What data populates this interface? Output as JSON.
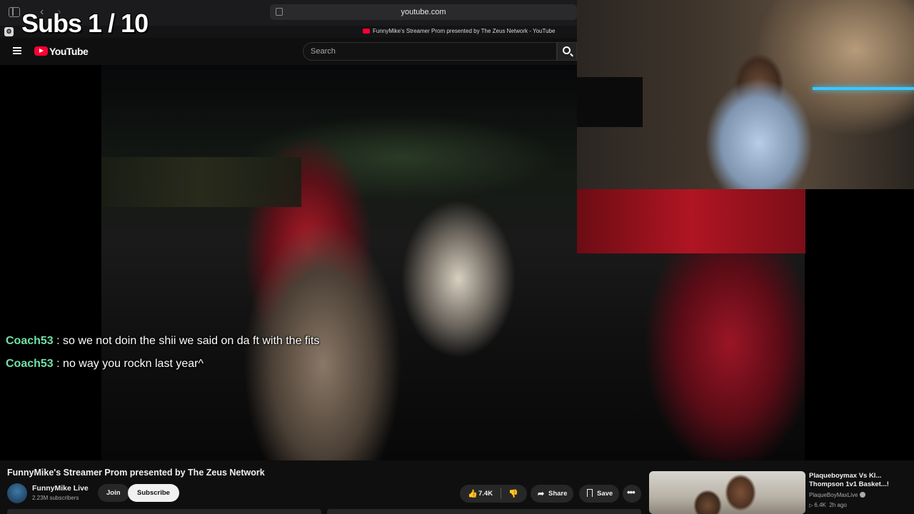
{
  "overlay": {
    "subs_text": "Subs 1 / 10"
  },
  "browser": {
    "address": "youtube.com",
    "tab_title": "FunnyMike's Streamer Prom presented by The Zeus Network - YouTube",
    "nav_back": "‹",
    "nav_forward": "›"
  },
  "youtube": {
    "logo_text": "YouTube",
    "search_placeholder": "Search"
  },
  "chat": [
    {
      "user": "Coach53",
      "separator": " : ",
      "message": "so we not doin the shii we said on da ft with the fits"
    },
    {
      "user": "Coach53",
      "separator": " : ",
      "message": "no way you rockn last year^"
    }
  ],
  "video": {
    "title": "FunnyMike's Streamer Prom presented by The Zeus Network",
    "channel_name": "FunnyMike Live",
    "channel_subs": "2.23M subscribers",
    "join_label": "Join",
    "subscribe_label": "Subscribe",
    "like_count": "7.4K",
    "share_label": "Share",
    "save_label": "Save",
    "more_label": "•••"
  },
  "icons": {
    "like": "👍",
    "dislike": "👎",
    "share": "➦",
    "play": "▷"
  },
  "recommendation": {
    "title": "Plaqueboymax Vs Kl... Thompson 1v1 Basket...!",
    "channel": "PlaqueBoyMaxLive",
    "views": "6.4K",
    "age": "2h ago"
  },
  "colors": {
    "youtube_red": "#ff0033",
    "chat_username": "#6fe0a8",
    "background": "#0f0f0f"
  }
}
